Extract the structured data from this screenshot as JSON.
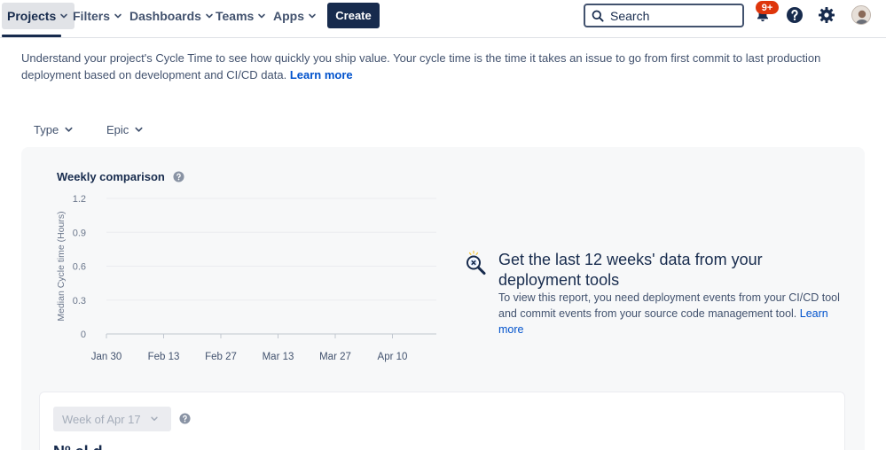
{
  "nav": {
    "items": [
      {
        "label": "Projects"
      },
      {
        "label": "Filters"
      },
      {
        "label": "Dashboards"
      },
      {
        "label": "Teams"
      },
      {
        "label": "Apps"
      }
    ],
    "create_label": "Create",
    "search_placeholder": "Search",
    "notification_count": "9+"
  },
  "intro": {
    "text": "Understand your project's Cycle Time to see how quickly you ship value. Your cycle time is the time it takes an issue to go from first commit to last production deployment based on development and CI/CD data.",
    "link": "Learn more"
  },
  "filters": [
    {
      "label": "Type"
    },
    {
      "label": "Epic"
    }
  ],
  "chart_panel": {
    "title": "Weekly comparison"
  },
  "chart_data": {
    "type": "line",
    "title": "Weekly comparison",
    "xlabel": "",
    "ylabel": "Median Cycle time (Hours)",
    "x_ticks": [
      "Jan 30",
      "Feb 13",
      "Feb 27",
      "Mar 13",
      "Mar 27",
      "Apr 10"
    ],
    "y_ticks": [
      "1.2",
      "0.9",
      "0.6",
      "0.3",
      "0"
    ],
    "ylim": [
      0,
      1.2
    ],
    "grid": true,
    "series": []
  },
  "empty_state": {
    "title": "Get the last 12 weeks' data from your deployment tools",
    "description": "To view this report, you need deployment events from your CI/CD tool and commit events from your source code management tool.",
    "link": "Learn more"
  },
  "week_card": {
    "select_value": "Week of Apr 17",
    "heading_partial": "Nº    el    d   "
  },
  "colors": {
    "nav_text": "#42526e",
    "primary_dark": "#172b4d",
    "link": "#0052cc",
    "badge": "#de350b",
    "panel_bg": "#f7f8f9"
  }
}
